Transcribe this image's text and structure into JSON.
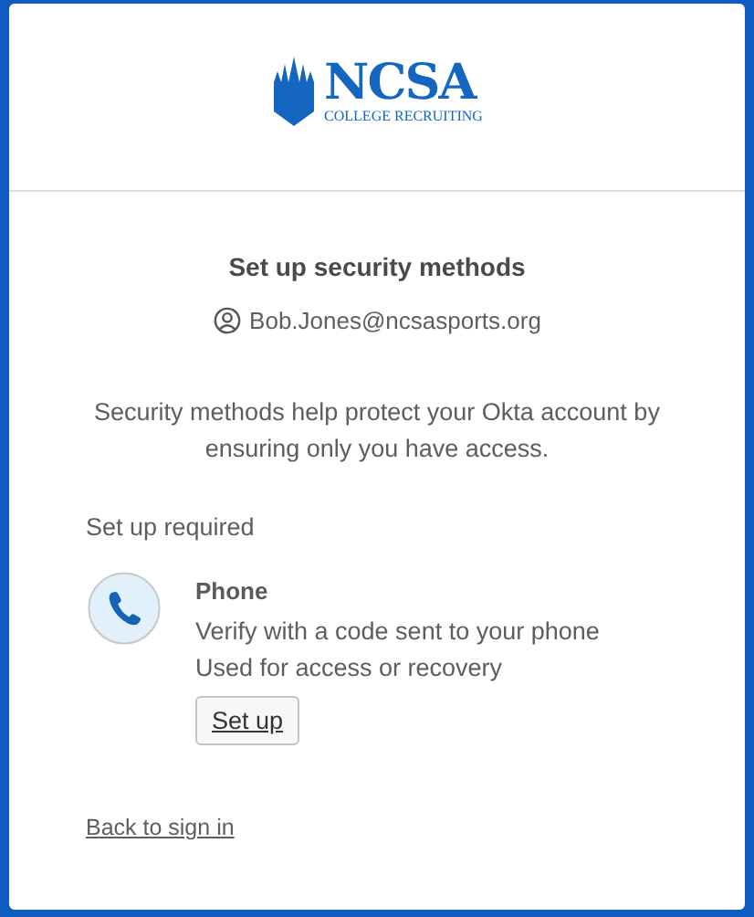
{
  "logo": {
    "name": "NCSA",
    "tagline": "COLLEGE RECRUITING"
  },
  "title": "Set up security methods",
  "user": "Bob.Jones@ncsasports.org",
  "description": "Security methods help protect your Okta account by ensuring only you have access.",
  "section_title": "Set up required",
  "methods": [
    {
      "kind": "phone",
      "name": "Phone",
      "lines": [
        "Verify with a code sent to your phone",
        "Used for access or recovery"
      ],
      "button": "Set up"
    }
  ],
  "back_link": "Back to sign in"
}
